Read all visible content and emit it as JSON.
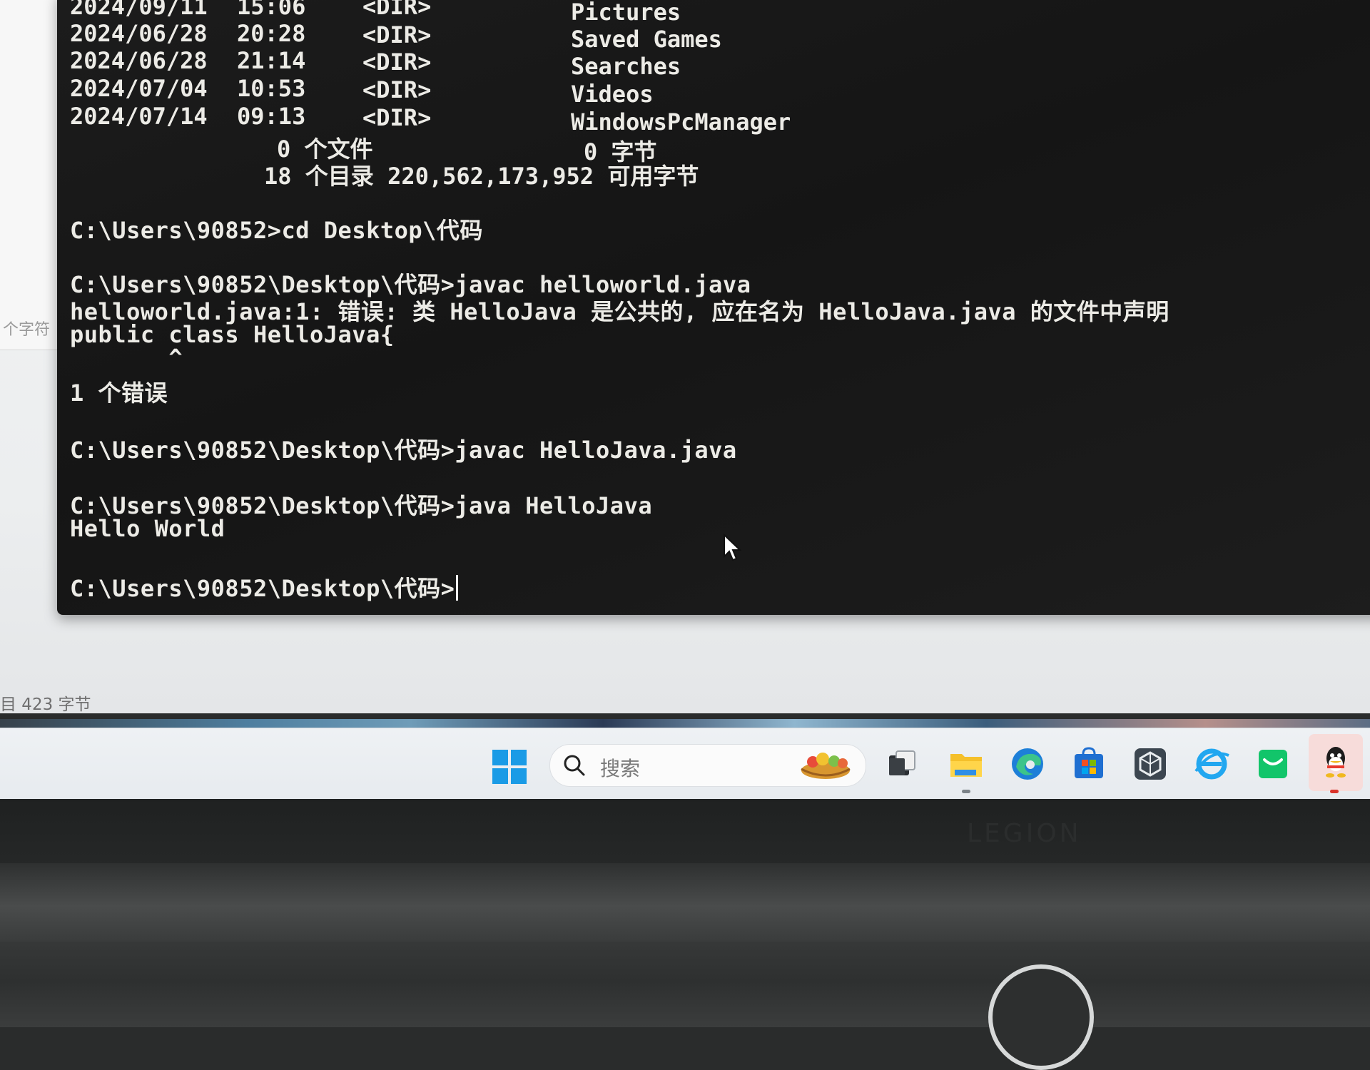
{
  "background_window": {
    "side_label": "个字符",
    "status_text": "目 423 字节"
  },
  "terminal": {
    "dir_listing": [
      {
        "date": "2024/09/11",
        "time": "15:06",
        "type": "<DIR>",
        "name": "Pictures"
      },
      {
        "date": "2024/06/28",
        "time": "20:28",
        "type": "<DIR>",
        "name": "Saved Games"
      },
      {
        "date": "2024/06/28",
        "time": "21:14",
        "type": "<DIR>",
        "name": "Searches"
      },
      {
        "date": "2024/07/04",
        "time": "10:53",
        "type": "<DIR>",
        "name": "Videos"
      },
      {
        "date": "2024/07/14",
        "time": "09:13",
        "type": "<DIR>",
        "name": "WindowsPcManager"
      }
    ],
    "summary_files": "0 个文件",
    "summary_files_bytes": "0 字节",
    "summary_dirs": "18 个目录 220,562,173,952 可用字节",
    "lines": [
      "C:\\Users\\90852>cd Desktop\\代码",
      "C:\\Users\\90852\\Desktop\\代码>javac helloworld.java",
      "helloworld.java:1: 错误: 类 HelloJava 是公共的, 应在名为 HelloJava.java 的文件中声明",
      "public class HelloJava{",
      "       ^",
      "1 个错误",
      "C:\\Users\\90852\\Desktop\\代码>javac HelloJava.java",
      "C:\\Users\\90852\\Desktop\\代码>java HelloJava",
      "Hello World",
      "C:\\Users\\90852\\Desktop\\代码>"
    ]
  },
  "taskbar": {
    "search_placeholder": "搜索",
    "icons": [
      "windows-start-icon",
      "task-view-icon",
      "file-explorer-icon",
      "edge-icon",
      "microsoft-store-icon",
      "cube-app-icon",
      "ie-browser-icon",
      "green-app-icon",
      "qq-icon"
    ]
  },
  "bezel": {
    "brand": "LEGION"
  }
}
